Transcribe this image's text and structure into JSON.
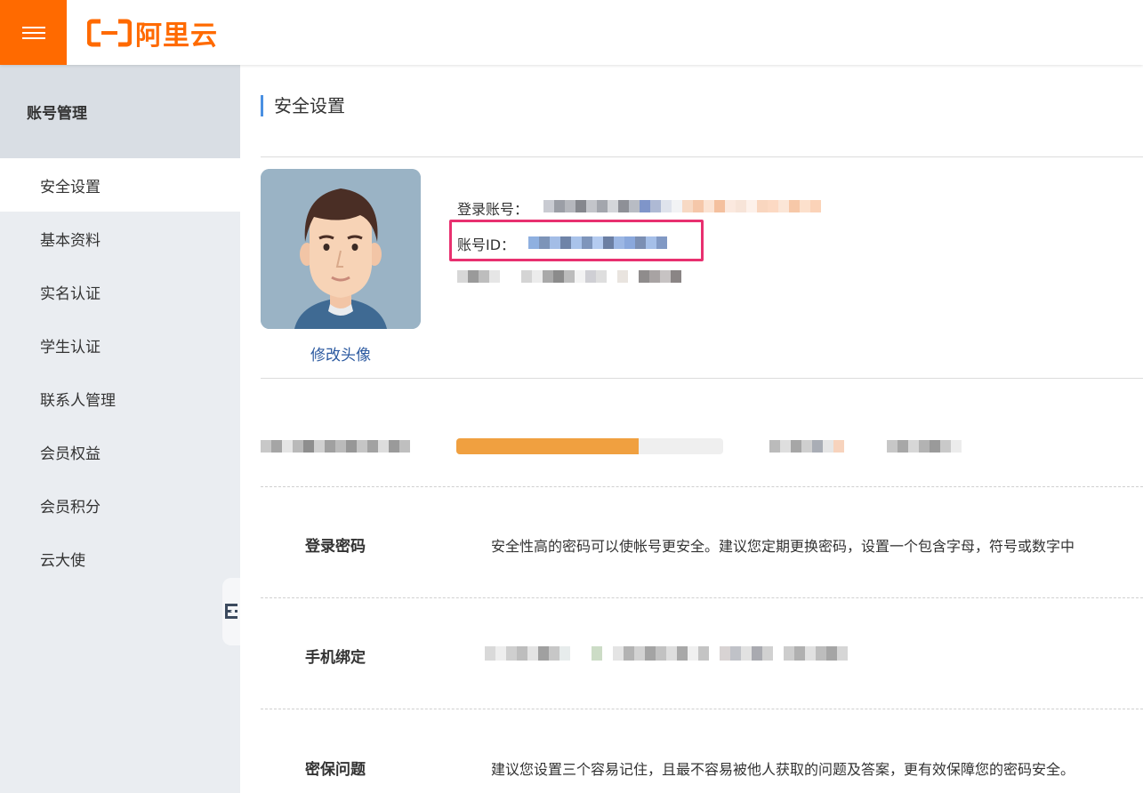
{
  "header": {
    "menu_icon": "hamburger-menu-icon",
    "logo_text": "阿里云",
    "brand_color": "#ff6a00"
  },
  "sidebar": {
    "title": "账号管理",
    "items": [
      {
        "label": "安全设置",
        "active": true
      },
      {
        "label": "基本资料",
        "active": false
      },
      {
        "label": "实名认证",
        "active": false
      },
      {
        "label": "学生认证",
        "active": false
      },
      {
        "label": "联系人管理",
        "active": false
      },
      {
        "label": "会员权益",
        "active": false
      },
      {
        "label": "会员积分",
        "active": false
      },
      {
        "label": "云大使",
        "active": false
      }
    ],
    "collapse_icon": "collapse-sidebar-icon"
  },
  "main": {
    "title": "安全设置",
    "avatar_link": "修改头像",
    "login_account_label": "登录账号：",
    "account_id_label": "账号ID：",
    "highlight_color": "#e8306f"
  },
  "security_items": [
    {
      "label": "登录密码",
      "desc": "安全性高的密码可以使帐号更安全。建议您定期更换密码，设置一个包含字母，符号或数字中"
    },
    {
      "label": "手机绑定",
      "desc": ""
    },
    {
      "label": "密保问题",
      "desc": "建议您设置三个容易记住，且最不容易被他人获取的问题及答案，更有效保障您的密码安全。"
    }
  ]
}
